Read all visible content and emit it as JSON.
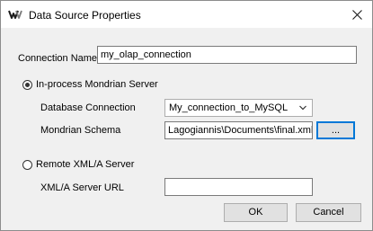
{
  "window": {
    "title": "Data Source Properties",
    "app_icon": "pentaho-icon",
    "close_icon": "close-icon"
  },
  "connection_name": {
    "label": "Connection Name",
    "value": "my_olap_connection"
  },
  "in_process": {
    "label": "In-process Mondrian Server",
    "selected": true,
    "database_connection": {
      "label": "Database Connection",
      "selected_value": "My_connection_to_MySQL"
    },
    "mondrian_schema": {
      "label": "Mondrian Schema",
      "value": "Lagogiannis\\Documents\\final.xml",
      "browse_label": "..."
    }
  },
  "remote": {
    "label": "Remote XML/A Server",
    "selected": false,
    "url": {
      "label": "XML/A Server URL",
      "value": ""
    }
  },
  "buttons": {
    "ok_label": "OK",
    "cancel_label": "Cancel"
  },
  "colors": {
    "dialog_bg": "#f0f0f0",
    "focus_border": "#0078d7"
  }
}
